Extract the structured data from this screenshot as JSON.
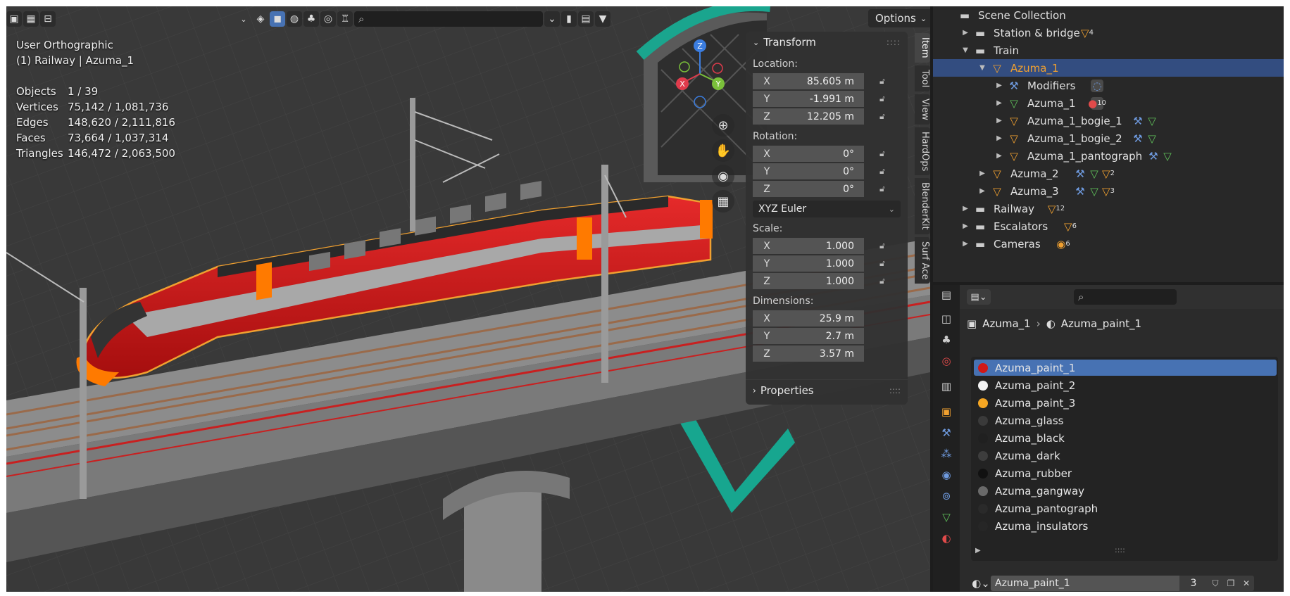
{
  "viewport": {
    "view_name": "User Orthographic",
    "context": "(1) Railway | Azuma_1",
    "options_label": "Options",
    "stats": [
      {
        "label": "Objects",
        "value": "1 / 39"
      },
      {
        "label": "Vertices",
        "value": "75,142 / 1,081,736"
      },
      {
        "label": "Edges",
        "value": "148,620 / 2,111,816"
      },
      {
        "label": "Faces",
        "value": "73,664 / 1,037,314"
      },
      {
        "label": "Triangles",
        "value": "146,472 / 2,063,500"
      }
    ],
    "gizmo": {
      "z": "Z",
      "x": "X",
      "y": "Y"
    }
  },
  "npanel": {
    "transform_title": "Transform",
    "location_label": "Location:",
    "location": [
      {
        "axis": "X",
        "value": "85.605 m"
      },
      {
        "axis": "Y",
        "value": "-1.991 m"
      },
      {
        "axis": "Z",
        "value": "12.205 m"
      }
    ],
    "rotation_label": "Rotation:",
    "rotation": [
      {
        "axis": "X",
        "value": "0°"
      },
      {
        "axis": "Y",
        "value": "0°"
      },
      {
        "axis": "Z",
        "value": "0°"
      }
    ],
    "rotation_mode": "XYZ Euler",
    "scale_label": "Scale:",
    "scale": [
      {
        "axis": "X",
        "value": "1.000"
      },
      {
        "axis": "Y",
        "value": "1.000"
      },
      {
        "axis": "Z",
        "value": "1.000"
      }
    ],
    "dimensions_label": "Dimensions:",
    "dimensions": [
      {
        "axis": "X",
        "value": "25.9 m"
      },
      {
        "axis": "Y",
        "value": "2.7 m"
      },
      {
        "axis": "Z",
        "value": "3.57 m"
      }
    ],
    "properties_title": "Properties",
    "tabs": [
      "Item",
      "Tool",
      "View",
      "HardOps",
      "BlenderKit",
      "Surf Ace"
    ]
  },
  "outliner": {
    "root": "Scene Collection",
    "rows": [
      {
        "label": "Station & bridge",
        "badge": "4"
      },
      {
        "label": "Train"
      },
      {
        "label": "Azuma_1"
      },
      {
        "label": "Modifiers"
      },
      {
        "label": "Azuma_1",
        "badge": "10"
      },
      {
        "label": "Azuma_1_bogie_1"
      },
      {
        "label": "Azuma_1_bogie_2"
      },
      {
        "label": "Azuma_1_pantograph"
      },
      {
        "label": "Azuma_2",
        "badge": "2"
      },
      {
        "label": "Azuma_3",
        "badge": "3"
      },
      {
        "label": "Railway",
        "badge": "12"
      },
      {
        "label": "Escalators",
        "badge": "6"
      },
      {
        "label": "Cameras",
        "badge": "6"
      }
    ]
  },
  "properties": {
    "breadcrumb_object": "Azuma_1",
    "breadcrumb_material": "Azuma_paint_1",
    "materials": [
      {
        "name": "Azuma_paint_1",
        "color": "#d01818"
      },
      {
        "name": "Azuma_paint_2",
        "color": "#f2f2f2"
      },
      {
        "name": "Azuma_paint_3",
        "color": "#f5a623"
      },
      {
        "name": "Azuma_glass",
        "color": "#3a3a3a"
      },
      {
        "name": "Azuma_black",
        "color": "#202020"
      },
      {
        "name": "Azuma_dark",
        "color": "#3d3d3d"
      },
      {
        "name": "Azuma_rubber",
        "color": "#111111"
      },
      {
        "name": "Azuma_gangway",
        "color": "#6a6a6a"
      },
      {
        "name": "Azuma_pantograph",
        "color": "#2a2a2a"
      },
      {
        "name": "Azuma_insulators",
        "color": "#262626"
      }
    ],
    "active_material": "Azuma_paint_1",
    "user_count": "3"
  },
  "colors": {
    "selection": "#4772b3",
    "outliner_selection": "#334d80",
    "object_orange": "#f0a030"
  }
}
